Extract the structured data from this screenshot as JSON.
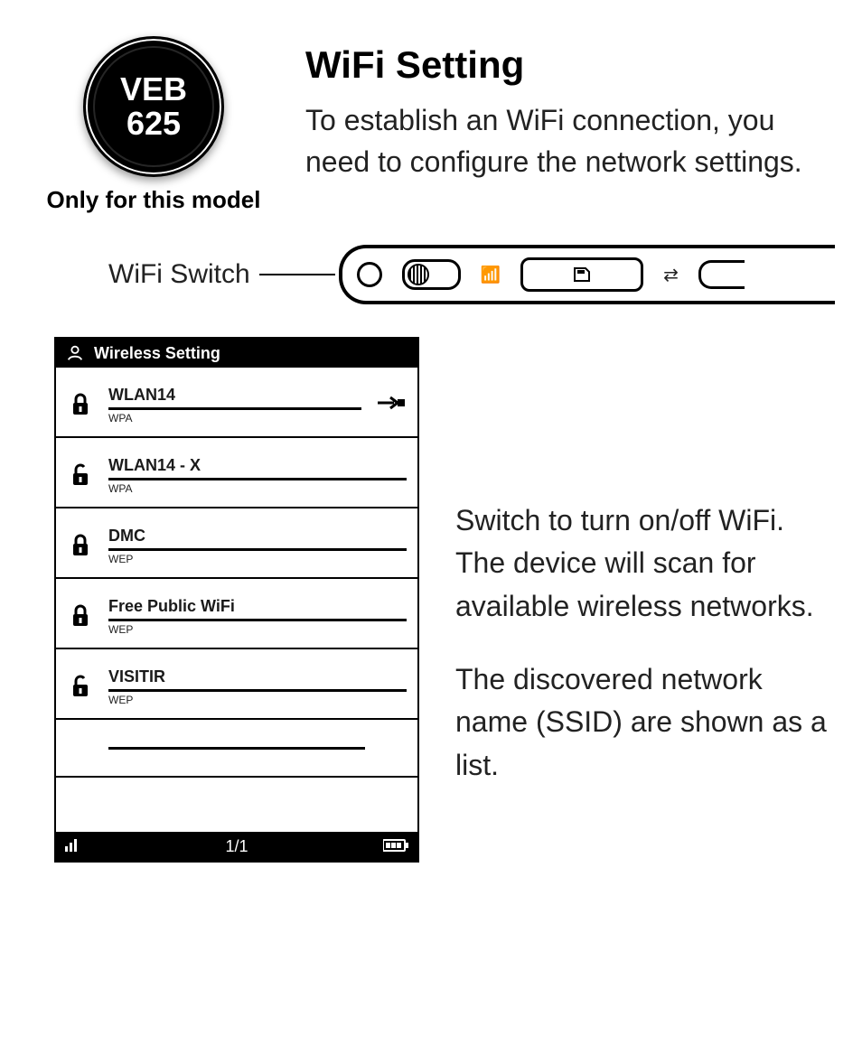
{
  "badge": {
    "line1": "VEB",
    "line2": "625",
    "caption": "Only for this model"
  },
  "title": "WiFi Setting",
  "intro": "To establish an WiFi connection, you need to configure the network settings.",
  "switch_label": "WiFi Switch",
  "screen": {
    "header": "Wireless Setting",
    "networks": [
      {
        "ssid": "WLAN14",
        "enc": "WPA",
        "locked": true,
        "selected": true
      },
      {
        "ssid": "WLAN14 - X",
        "enc": "WPA",
        "locked": false,
        "selected": false
      },
      {
        "ssid": "DMC",
        "enc": "WEP",
        "locked": true,
        "selected": false
      },
      {
        "ssid": "Free Public WiFi",
        "enc": "WEP",
        "locked": true,
        "selected": false
      },
      {
        "ssid": "VISITIR",
        "enc": "WEP",
        "locked": false,
        "selected": false
      }
    ],
    "footer": {
      "page": "1/1",
      "signal": "▮▯▯",
      "battery": "▮▮▮"
    }
  },
  "body": {
    "p1": "Switch to turn on/off WiFi. The device will scan for available wireless networks.",
    "p2": "The discovered network name (SSID) are shown as a list."
  }
}
